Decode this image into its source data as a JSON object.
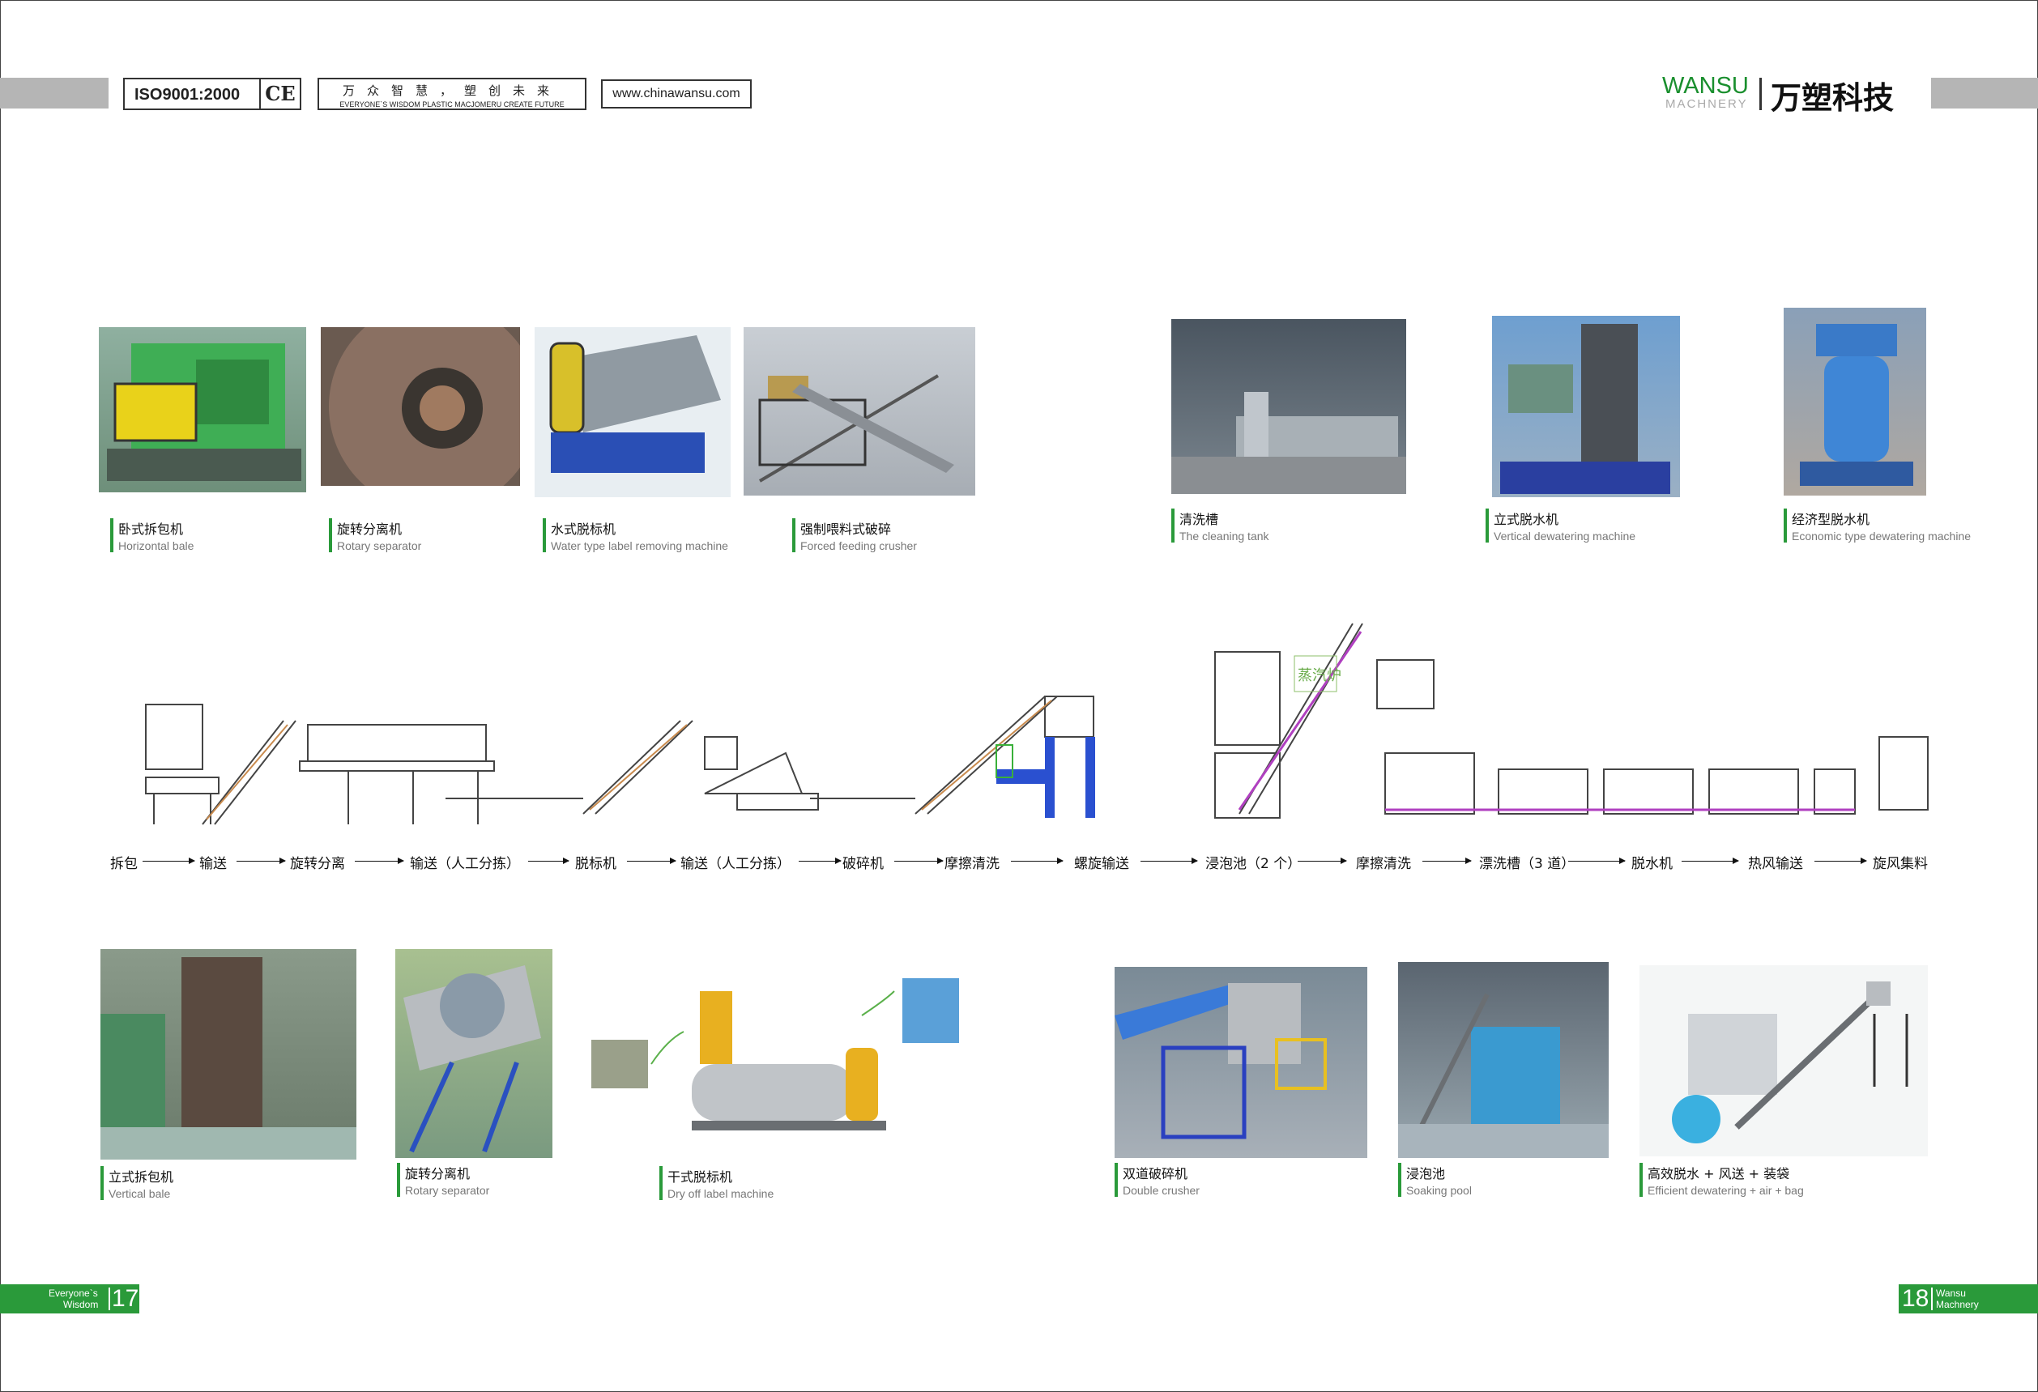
{
  "header": {
    "iso": "ISO9001:2000",
    "ce": "CE",
    "slogan_cn": "万众智慧，塑创未来",
    "slogan_en": "EVERYONE`S WISDOM PLASTIC MACJOMERU CREATE FUTURE",
    "website": "www.chinawansu.com",
    "brand_en": "WANSU",
    "brand_sub": "MACHNERY",
    "brand_cn": "万塑科技"
  },
  "photos_top": [
    {
      "cn": "卧式拆包机",
      "en": "Horizontal bale"
    },
    {
      "cn": "旋转分离机",
      "en": "Rotary separator"
    },
    {
      "cn": "水式脱标机",
      "en": "Water type label removing machine"
    },
    {
      "cn": "强制喂料式破碎",
      "en": "Forced feeding crusher"
    },
    {
      "cn": "清洗槽",
      "en": "The cleaning tank"
    },
    {
      "cn": "立式脱水机",
      "en": "Vertical dewatering machine"
    },
    {
      "cn": "经济型脱水机",
      "en": "Economic type dewatering machine"
    }
  ],
  "diagram": {
    "boiler_label": "蒸汽炉"
  },
  "flow": [
    "拆包",
    "输送",
    "旋转分离",
    "输送（人工分拣）",
    "脱标机",
    "输送（人工分拣）",
    "破碎机",
    "摩擦清洗",
    "螺旋输送",
    "浸泡池（2 个）",
    "摩擦清洗",
    "漂洗槽（3 道）",
    "脱水机",
    "热风输送",
    "旋风集料"
  ],
  "photos_bottom": [
    {
      "cn": "立式拆包机",
      "en": "Vertical bale"
    },
    {
      "cn": "旋转分离机",
      "en": "Rotary separator"
    },
    {
      "cn": "干式脱标机",
      "en": "Dry off label machine"
    },
    {
      "cn": "双道破碎机",
      "en": "Double crusher"
    },
    {
      "cn": "浸泡池",
      "en": "Soaking pool"
    },
    {
      "cn": "高效脱水 + 风送 + 装袋",
      "en": "Efficient dewatering + air + bag"
    }
  ],
  "footer": {
    "left_text_1": "Everyone`s",
    "left_text_2": "Wisdom",
    "left_page": "17",
    "right_page": "18",
    "right_text_1": "Wansu",
    "right_text_2": "Machnery"
  },
  "colors": {
    "accent_green": "#2a9a3a",
    "brand_green": "#1a8f2e",
    "header_gray": "#b5b5b5"
  }
}
